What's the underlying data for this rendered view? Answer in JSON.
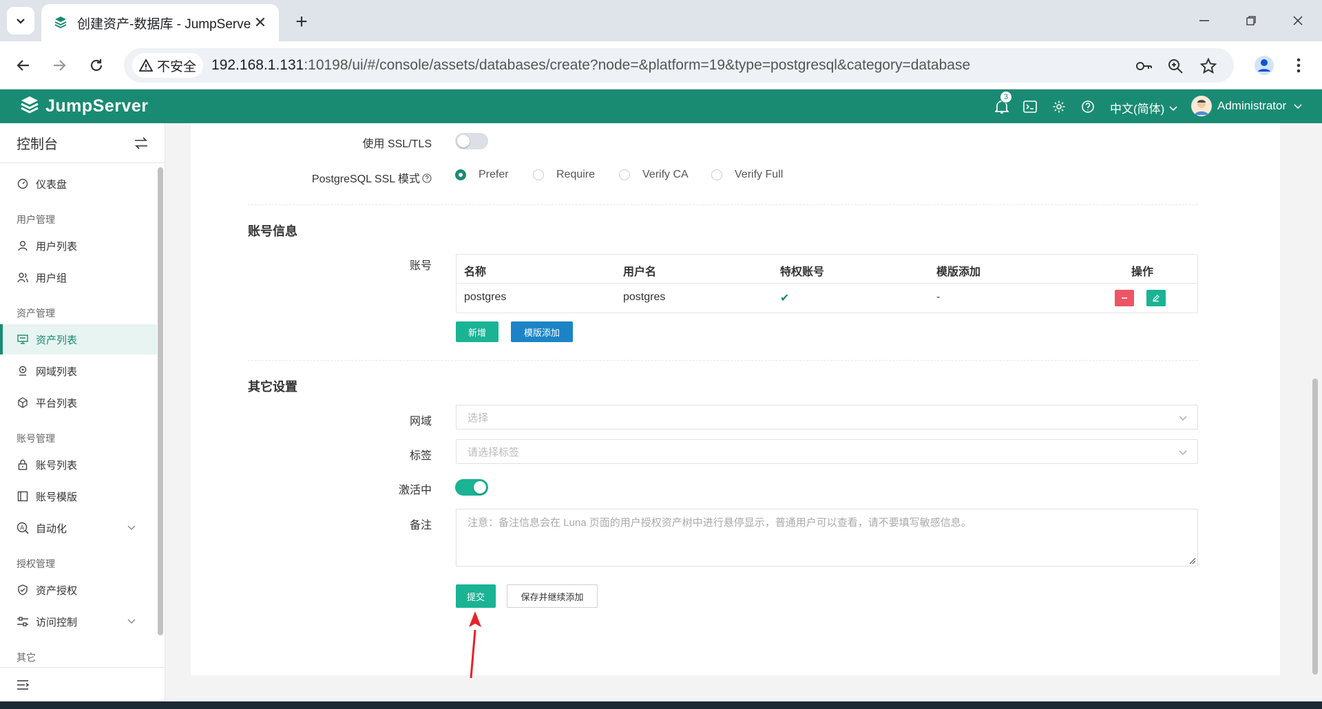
{
  "browser": {
    "tab_title": "创建资产-数据库 - JumpServer",
    "tab_close": "✕",
    "new_tab": "+",
    "insecure_label": "不安全",
    "url_host": "192.168.1.131",
    "url_rest": ":10198/ui/#/console/assets/databases/create?node=&platform=19&type=postgresql&category=database"
  },
  "header": {
    "logo_text": "JumpServer",
    "notification_count": "3",
    "language": "中文(简体)",
    "user_name": "Administrator",
    "brand_color": "#1a8b73"
  },
  "sidebar": {
    "title": "控制台",
    "items": [
      {
        "label": "仪表盘",
        "icon": "dashboard-icon"
      },
      {
        "group": "用户管理"
      },
      {
        "label": "用户列表",
        "icon": "user-icon"
      },
      {
        "label": "用户组",
        "icon": "users-icon"
      },
      {
        "group": "资产管理"
      },
      {
        "label": "资产列表",
        "icon": "monitor-icon",
        "active": true
      },
      {
        "label": "网域列表",
        "icon": "location-icon"
      },
      {
        "label": "平台列表",
        "icon": "cube-icon"
      },
      {
        "group": "账号管理"
      },
      {
        "label": "账号列表",
        "icon": "lock-icon"
      },
      {
        "label": "账号模版",
        "icon": "template-icon"
      },
      {
        "label": "自动化",
        "icon": "automation-icon",
        "expandable": true
      },
      {
        "group": "授权管理"
      },
      {
        "label": "资产授权",
        "icon": "shield-icon"
      },
      {
        "label": "访问控制",
        "icon": "sliders-icon",
        "expandable": true
      },
      {
        "group": "其它"
      }
    ]
  },
  "form": {
    "ssl_label": "使用 SSL/TLS",
    "ssl_enabled": false,
    "ssl_mode_label": "PostgreSQL SSL 模式",
    "ssl_mode_options": [
      "Prefer",
      "Require",
      "Verify CA",
      "Verify Full"
    ],
    "ssl_mode_selected": "Prefer",
    "account_section": "账号信息",
    "account_label": "账号",
    "account_table": {
      "headers": [
        "名称",
        "用户名",
        "特权账号",
        "模版添加",
        "操作"
      ],
      "rows": [
        {
          "name": "postgres",
          "username": "postgres",
          "privileged": "✔",
          "template": "-"
        }
      ]
    },
    "add_button": "新增",
    "template_add_button": "模版添加",
    "other_section": "其它设置",
    "domain_label": "网域",
    "domain_placeholder": "选择",
    "labels_label": "标签",
    "labels_placeholder": "请选择标签",
    "active_label": "激活中",
    "active_enabled": true,
    "comment_label": "备注",
    "comment_placeholder": "注意：备注信息会在 Luna 页面的用户授权资产树中进行悬停显示，普通用户可以查看，请不要填写敏感信息。",
    "submit_button": "提交",
    "save_continue_button": "保存并继续添加"
  }
}
